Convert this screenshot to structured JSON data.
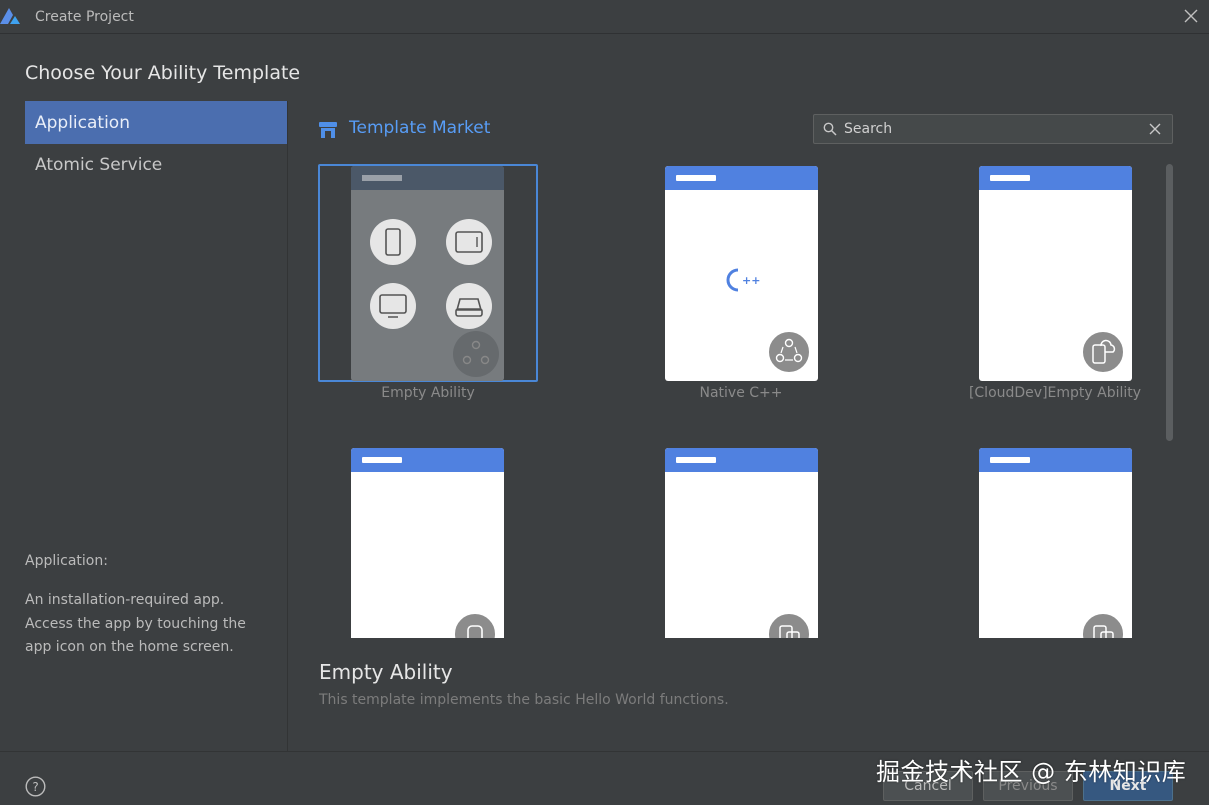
{
  "window": {
    "title": "Create Project"
  },
  "heading": "Choose Your Ability Template",
  "sidebar": {
    "items": [
      {
        "label": "Application",
        "active": true
      },
      {
        "label": "Atomic Service",
        "active": false
      }
    ],
    "description_title": "Application:",
    "description_body": "An installation-required app. Access the app by touching the app icon on the home screen."
  },
  "market": {
    "title": "Template Market",
    "search_placeholder": "Search"
  },
  "templates": [
    {
      "label": "Empty Ability",
      "selected": true,
      "badge_icon": "atom-icon"
    },
    {
      "label": "Native C++",
      "selected": false,
      "badge_icon": "atom-icon",
      "center_icon": "cpp-icon"
    },
    {
      "label": "[CloudDev]Empty Ability",
      "selected": false,
      "badge_icon": "cloud-device-icon"
    },
    {
      "label": "",
      "selected": false,
      "badge_icon": "watch-icon"
    },
    {
      "label": "",
      "selected": false,
      "badge_icon": "multi-device-icon"
    },
    {
      "label": "",
      "selected": false,
      "badge_icon": "multi-device-icon"
    }
  ],
  "detail": {
    "title": "Empty Ability",
    "description": "This template implements the basic Hello World functions."
  },
  "buttons": {
    "cancel": "Cancel",
    "previous": "Previous",
    "next": "Next"
  },
  "watermark": "掘金技术社区 @ 东林知识库",
  "colors": {
    "accent": "#4b6eaf",
    "link": "#589df6",
    "card_header": "#5081e0",
    "background": "#3c3f41"
  }
}
